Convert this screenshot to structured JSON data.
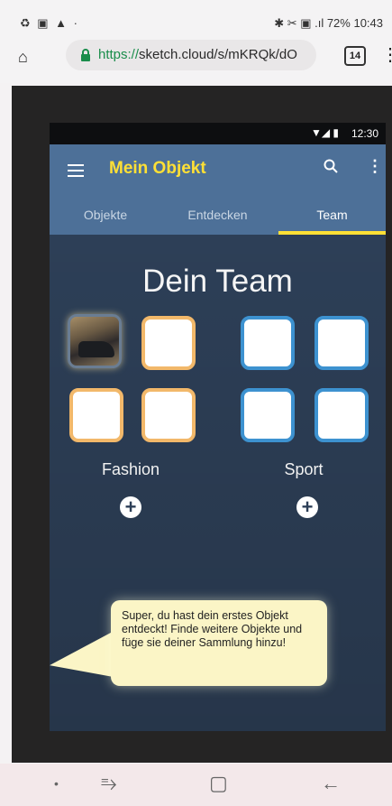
{
  "device_status": {
    "left_icons": "♻ ▣ ▲ ·",
    "right_text": "✱ ✂ ▣ .ıl 72% 10:43"
  },
  "browser": {
    "url_proto": "https://",
    "url_rest": "sketch.cloud/s/mKRQk/dO",
    "tabs_count": "14"
  },
  "app": {
    "status_time": "12:30",
    "title": "Mein Objekt",
    "tabs": [
      {
        "label": "Objekte"
      },
      {
        "label": "Entdecken"
      },
      {
        "label": "Team"
      }
    ],
    "active_tab": "Team"
  },
  "team": {
    "heading": "Dein Team",
    "groups": [
      {
        "label": "Fashion",
        "color": "#f2b86a"
      },
      {
        "label": "Sport",
        "color": "#3d92d0"
      }
    ],
    "plus_symbol": "+"
  },
  "bubble": {
    "text": "Super, du hast dein erstes Objekt entdeckt! Finde weitere Objekte und füge sie deiner Sammlung hinzu!"
  },
  "colors": {
    "appbar": "#4d7098",
    "accent": "#ffe035",
    "content_bg": "#2d3f57",
    "bubble_bg": "#fbf5c6"
  }
}
